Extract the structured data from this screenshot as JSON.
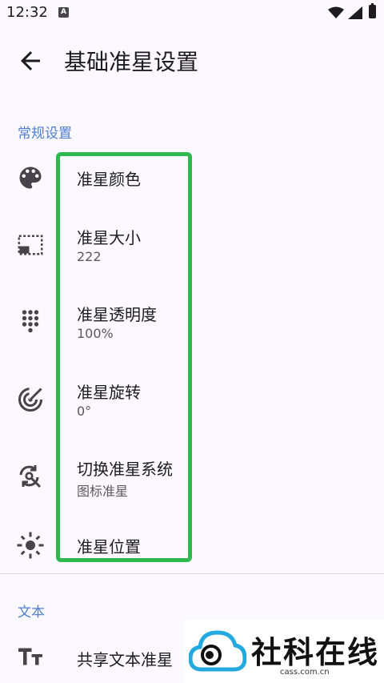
{
  "status_bar": {
    "time": "12:32",
    "notification_icon": "A"
  },
  "header": {
    "title": "基础准星设置"
  },
  "sections": [
    {
      "label": "常规设置"
    },
    {
      "label": "文本"
    }
  ],
  "items": [
    {
      "title": "准星颜色",
      "subtitle": ""
    },
    {
      "title": "准星大小",
      "subtitle": "222"
    },
    {
      "title": "准星透明度",
      "subtitle": "100%"
    },
    {
      "title": "准星旋转",
      "subtitle": "0°"
    },
    {
      "title": "切换准星系统",
      "subtitle": "图标准星"
    },
    {
      "title": "准星位置",
      "subtitle": ""
    },
    {
      "title": "共享文本准星",
      "subtitle": ""
    }
  ],
  "watermark": {
    "brand": "社科在线",
    "domain": "cass.com.cn"
  },
  "colors": {
    "accent": "#4e7fd0",
    "highlight": "#2fb850",
    "background": "#fcf8ff"
  }
}
